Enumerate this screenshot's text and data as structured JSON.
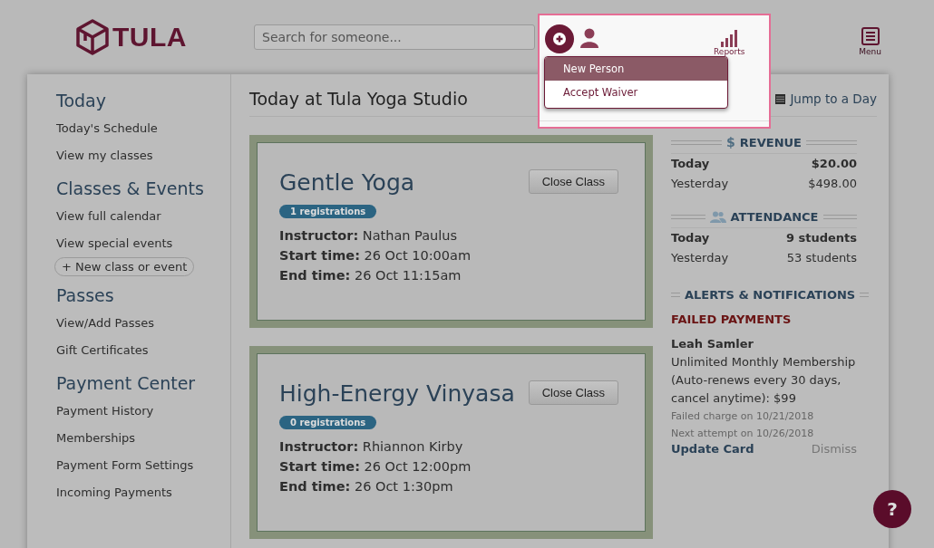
{
  "logo": {
    "text": "TULA"
  },
  "search": {
    "placeholder": "Search for someone..."
  },
  "nav": [
    {
      "kind": "add"
    },
    {
      "kind": "view"
    },
    {
      "kind": "reports",
      "label": "Reports"
    }
  ],
  "dropdown": [
    {
      "label": "New Person",
      "selected": true
    },
    {
      "label": "Accept Waiver",
      "selected": false
    }
  ],
  "menu": {
    "label": "Menu"
  },
  "sidebar": [
    {
      "heading": "Today",
      "items": [
        {
          "kind": "link",
          "label": "Today's Schedule"
        },
        {
          "kind": "link",
          "label": "View my classes"
        }
      ]
    },
    {
      "heading": "Classes & Events",
      "items": [
        {
          "kind": "link",
          "label": "View full calendar"
        },
        {
          "kind": "link",
          "label": "View special events"
        },
        {
          "kind": "button",
          "label": "+ New class or event"
        }
      ]
    },
    {
      "heading": "Passes",
      "items": [
        {
          "kind": "link",
          "label": "View/Add Passes"
        },
        {
          "kind": "link",
          "label": "Gift Certificates"
        }
      ]
    },
    {
      "heading": "Payment Center",
      "items": [
        {
          "kind": "link",
          "label": "Payment History"
        },
        {
          "kind": "link",
          "label": "Memberships"
        },
        {
          "kind": "link",
          "label": "Payment Form Settings"
        },
        {
          "kind": "link",
          "label": "Incoming Payments"
        }
      ]
    }
  ],
  "page_title": "Today at Tula Yoga Studio",
  "jump": {
    "label": "Jump to a Day"
  },
  "classes": [
    {
      "name": "Gentle Yoga",
      "registrations": "1 registrations",
      "button": "Close Class",
      "fields": [
        {
          "label": "Instructor:",
          "value": "Nathan Paulus"
        },
        {
          "label": "Start time:",
          "value": "26 Oct 10:00am"
        },
        {
          "label": "End time:",
          "value": "26 Oct 11:15am"
        }
      ]
    },
    {
      "name": "High-Energy Vinyasa",
      "registrations": "0 registrations",
      "button": "Close Class",
      "fields": [
        {
          "label": "Instructor:",
          "value": "Rhiannon Kirby"
        },
        {
          "label": "Start time:",
          "value": "26 Oct 12:00pm"
        },
        {
          "label": "End time:",
          "value": "26 Oct 1:30pm"
        }
      ]
    }
  ],
  "revenue": {
    "title": "REVENUE",
    "icon": "$",
    "rows": [
      {
        "label": "Today",
        "value": "$20.00"
      },
      {
        "label": "Yesterday",
        "value": "$498.00"
      }
    ]
  },
  "attendance": {
    "title": "ATTENDANCE",
    "rows": [
      {
        "label": "Today",
        "value": "9 students"
      },
      {
        "label": "Yesterday",
        "value": "53 students"
      }
    ]
  },
  "alerts": {
    "title": "ALERTS & NOTIFICATIONS",
    "subtitle": "FAILED PAYMENTS",
    "name": "Leah Samler",
    "description": "Unlimited Monthly Membership (Auto-renews every 30 days, cancel anytime): $99",
    "notes": [
      "Failed charge on 10/21/2018",
      "Next attempt on 10/26/2018"
    ],
    "action": "Update Card",
    "dismiss": "Dismiss"
  },
  "help": {
    "label": "?"
  }
}
